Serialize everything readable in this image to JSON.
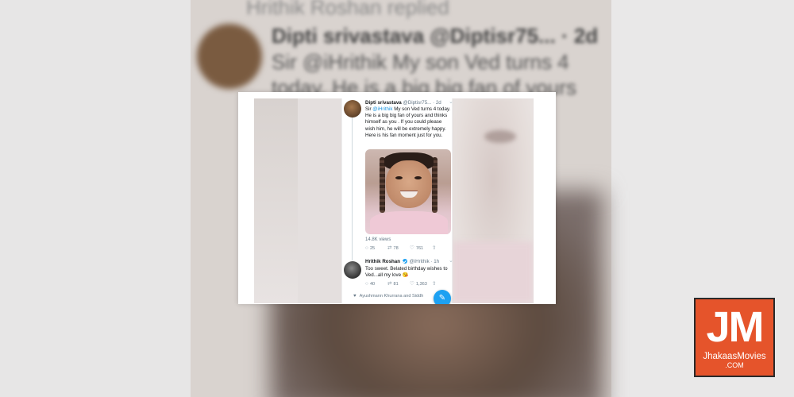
{
  "background": {
    "line1": "Hrithik Roshan replied",
    "line2": "Dipti srivastava @Diptisr75... · 2d",
    "line3": "Sir @iHrithik My son Ved turns 4",
    "line4": "today. He is a big big fan of yours"
  },
  "tweet_original": {
    "name": "Dipti srivastava",
    "handle": "@Diptisr75...",
    "time": "· 2d",
    "text_prefix": "Sir ",
    "mention": "@iHrithik",
    "text_body": " My son Ved turns 4 today. He is a big big fan of yours and thinks himself as you . If you could please wish him, he will be extremely happy. Here is his fan moment just for you.",
    "views": "14.8K views",
    "replies": "25",
    "retweets": "78",
    "likes": "761"
  },
  "tweet_reply": {
    "name": "Hrithik Roshan",
    "handle": "@iHrithik",
    "time": "· 1h",
    "text": "Too sweet. Belated birthday wishes to Ved...all my love 😘",
    "replies": "40",
    "retweets": "81",
    "likes": "1,363"
  },
  "liked_by": "Ayushmann Khurrana and Siddh",
  "logo": {
    "mark": "JM",
    "name": "JhakaasMovies",
    "domain": ".COM"
  },
  "colors": {
    "accent": "#1da1f2",
    "logo_bg": "#e5542b"
  },
  "icons": {
    "reply": "reply-icon",
    "retweet": "retweet-icon",
    "like": "heart-icon",
    "share": "share-icon",
    "compose": "compose-tweet-icon",
    "verified": "verified-badge-icon"
  }
}
